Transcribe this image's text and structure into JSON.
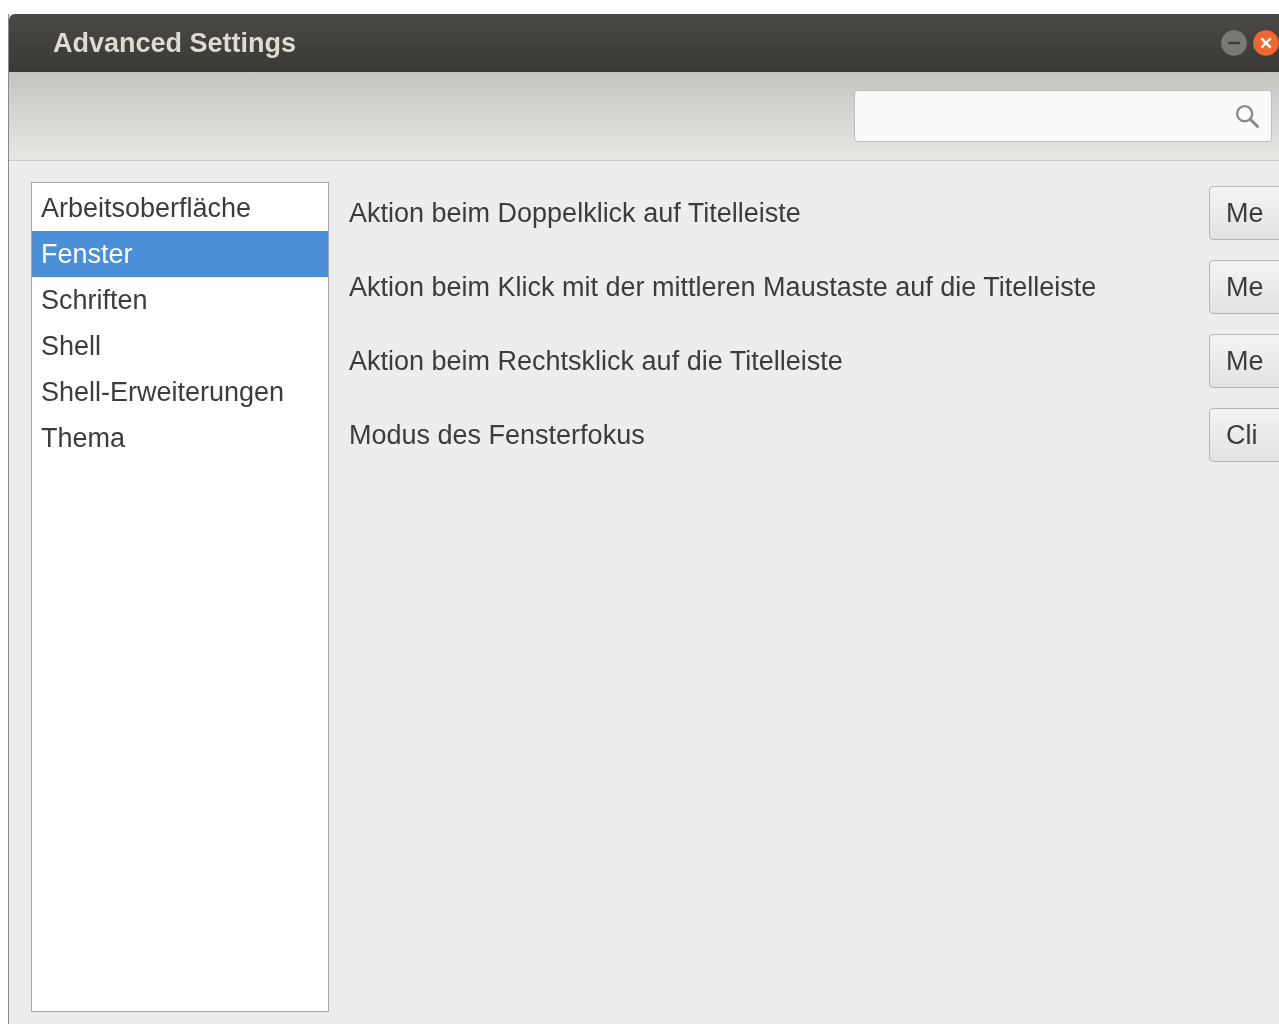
{
  "window": {
    "title": "Advanced Settings"
  },
  "sidebar": {
    "items": [
      {
        "label": "Arbeitsoberfläche",
        "selected": false
      },
      {
        "label": "Fenster",
        "selected": true
      },
      {
        "label": "Schriften",
        "selected": false
      },
      {
        "label": "Shell",
        "selected": false
      },
      {
        "label": "Shell-Erweiterungen",
        "selected": false
      },
      {
        "label": "Thema",
        "selected": false
      }
    ]
  },
  "settings": [
    {
      "label": "Aktion beim Doppelklick auf Titelleiste",
      "value": "Me"
    },
    {
      "label": "Aktion beim Klick mit der mittleren Maustaste auf die Titelleiste",
      "value": "Me"
    },
    {
      "label": "Aktion beim Rechtsklick auf die Titelleiste",
      "value": "Me"
    },
    {
      "label": "Modus des Fensterfokus",
      "value": "Cli"
    }
  ]
}
